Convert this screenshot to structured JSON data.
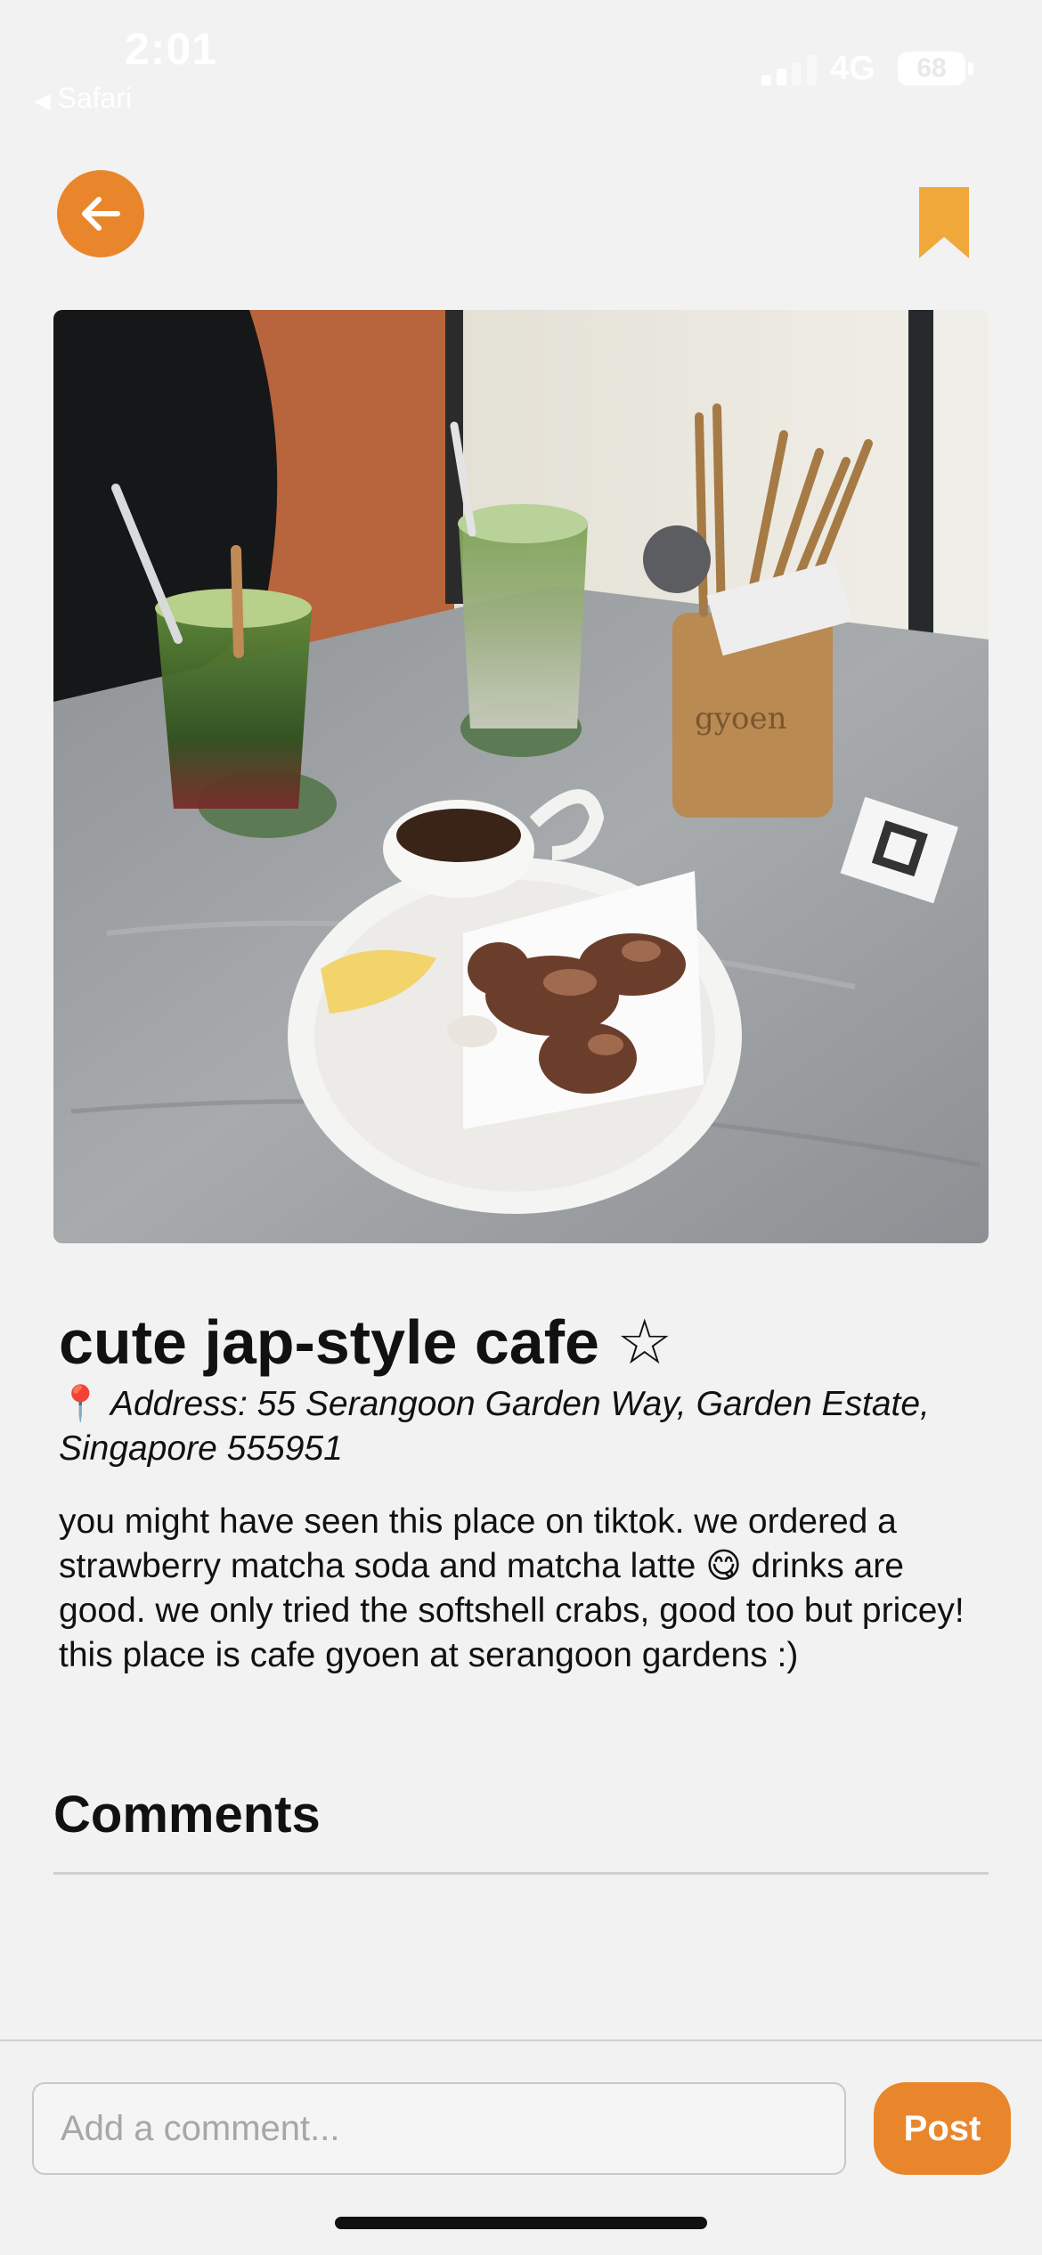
{
  "status_bar": {
    "time": "2:01",
    "back_app": "Safari",
    "network": "4G",
    "battery": "68"
  },
  "nav": {
    "back_icon": "arrow-left-icon",
    "bookmark_icon": "bookmark-icon"
  },
  "post": {
    "photo_alt": "cafe food photo",
    "title": "cute jap-style cafe ☆",
    "address_pin": "📍",
    "address": "Address: 55 Serangoon Garden Way, Garden Estate, Singapore 555951",
    "description": "you might have seen this place on tiktok. we ordered a strawberry matcha soda and matcha latte 😋 drinks are good. we only tried the softshell crabs, good too but pricey! this place is cafe gyoen at serangoon gardens :)"
  },
  "comments": {
    "heading": "Comments"
  },
  "composer": {
    "placeholder": "Add a comment...",
    "post_label": "Post"
  },
  "colors": {
    "accent": "#e9862c",
    "bookmark": "#f0a83a",
    "background": "#f2f2f2"
  }
}
